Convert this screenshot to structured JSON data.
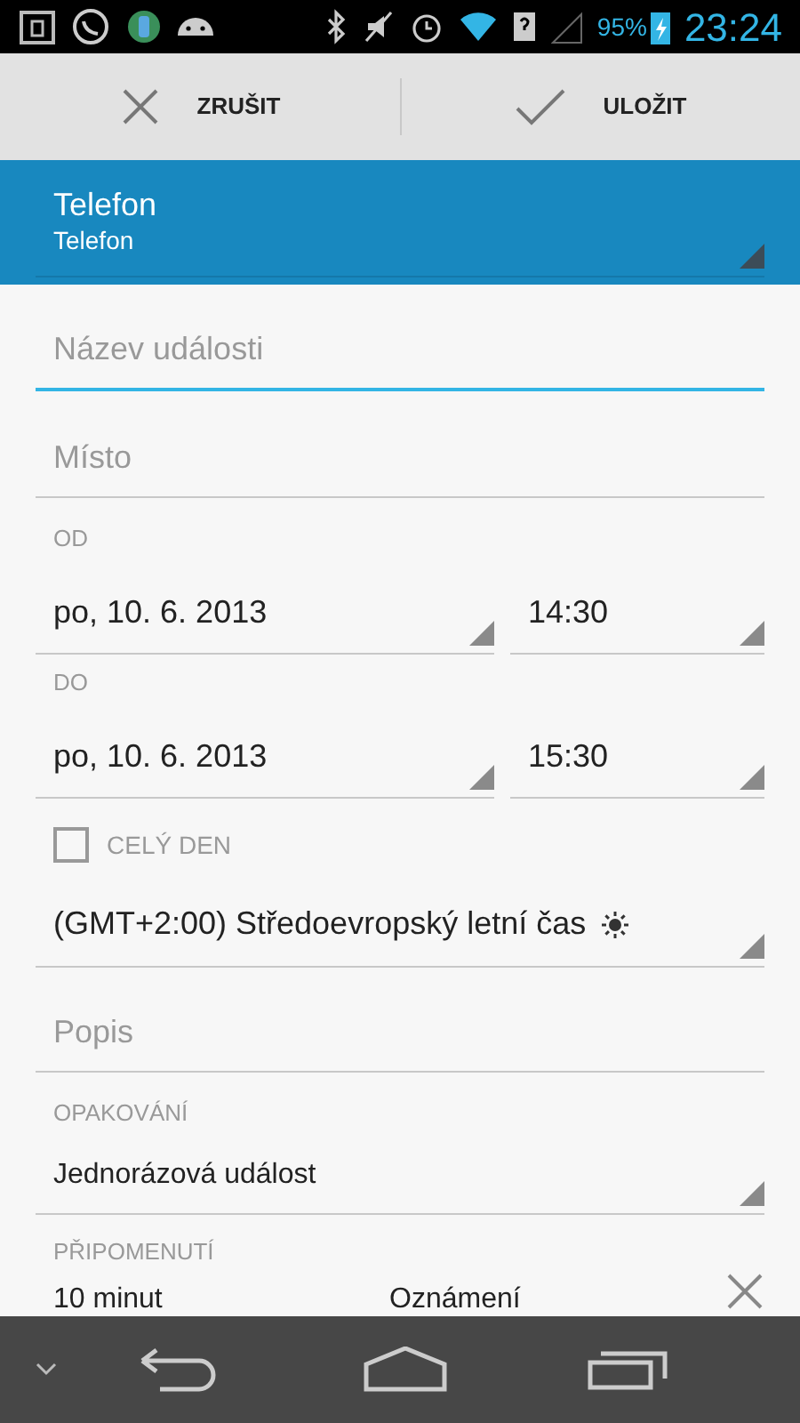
{
  "status_bar": {
    "battery": "95%",
    "time": "23:24"
  },
  "action_bar": {
    "buttons": [
      {
        "kind": "cancel",
        "label": "ZRUŠIT"
      },
      {
        "kind": "save",
        "label": "ULOŽIT"
      }
    ]
  },
  "calendar": {
    "name": "Telefon",
    "account": "Telefon"
  },
  "title_field": {
    "placeholder": "Název události",
    "focused": true
  },
  "location_field": {
    "placeholder": "Místo",
    "focused": false
  },
  "from": {
    "label": "OD",
    "date": "po, 10. 6. 2013",
    "time": "14:30"
  },
  "to": {
    "label": "DO",
    "date": "po, 10. 6. 2013",
    "time": "15:30"
  },
  "all_day": {
    "label": "CELÝ DEN",
    "checked": false
  },
  "timezone": "(GMT+2:00) Středoevropský letní čas",
  "description_field": {
    "placeholder": "Popis",
    "focused": false
  },
  "repeat": {
    "label": "OPAKOVÁNÍ",
    "value": "Jednorázová událost"
  },
  "reminders": {
    "label": "PŘIPOMENUTÍ",
    "items": [
      {
        "time": "10 minut",
        "method": "Oznámení"
      }
    ]
  }
}
